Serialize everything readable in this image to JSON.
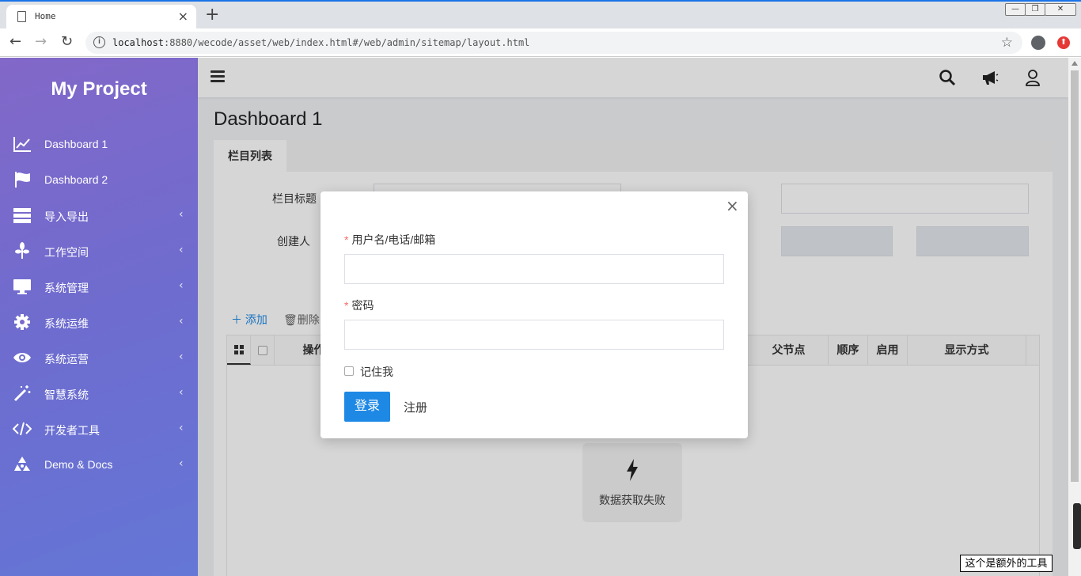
{
  "browser": {
    "tab_title": "Home",
    "tab_close": "×",
    "new_tab": "+",
    "url_host": "localhost",
    "url_rest": ":8880/wecode/asset/web/index.html#/web/admin/sitemap/layout.html",
    "back": "←",
    "forward": "→",
    "reload": "↻",
    "star": "☆"
  },
  "sidebar": {
    "brand": "My Project",
    "items": [
      {
        "label": "Dashboard 1",
        "icon": "line-chart-icon",
        "arrow": ""
      },
      {
        "label": "Dashboard 2",
        "icon": "flag-icon",
        "arrow": ""
      },
      {
        "label": "导入导出",
        "icon": "server-icon",
        "arrow": "‹"
      },
      {
        "label": "工作空间",
        "icon": "plant-icon",
        "arrow": "‹"
      },
      {
        "label": "系统管理",
        "icon": "monitor-icon",
        "arrow": "‹"
      },
      {
        "label": "系统运维",
        "icon": "gear-icon",
        "arrow": "‹"
      },
      {
        "label": "系统运营",
        "icon": "eye-icon",
        "arrow": "‹"
      },
      {
        "label": "智慧系统",
        "icon": "magic-wand-icon",
        "arrow": "‹"
      },
      {
        "label": "开发者工具",
        "icon": "code-icon",
        "arrow": "‹"
      },
      {
        "label": "Demo & Docs",
        "icon": "recycle-icon",
        "arrow": "‹"
      }
    ]
  },
  "page": {
    "title": "Dashboard 1",
    "tab": "栏目列表",
    "form": {
      "title_label": "栏目标题",
      "creator_label": "创建人"
    },
    "toolbar": {
      "add": "添加",
      "delete": "删除"
    },
    "grid": {
      "columns": [
        "操作",
        "父节点",
        "顺序",
        "启用",
        "显示方式"
      ]
    },
    "empty_state": "数据获取失败"
  },
  "modal": {
    "close": "×",
    "username_label": "用户名/电话/邮箱",
    "password_label": "密码",
    "remember_label": "记住我",
    "login_button": "登录",
    "register_link": "注册",
    "required_mark": "*"
  },
  "extra_tool": "这个是额外的工具",
  "colors": {
    "sidebar_start": "#8268c8",
    "sidebar_end": "#6476d6",
    "primary": "#1e88e5",
    "required": "#f56c6c"
  }
}
